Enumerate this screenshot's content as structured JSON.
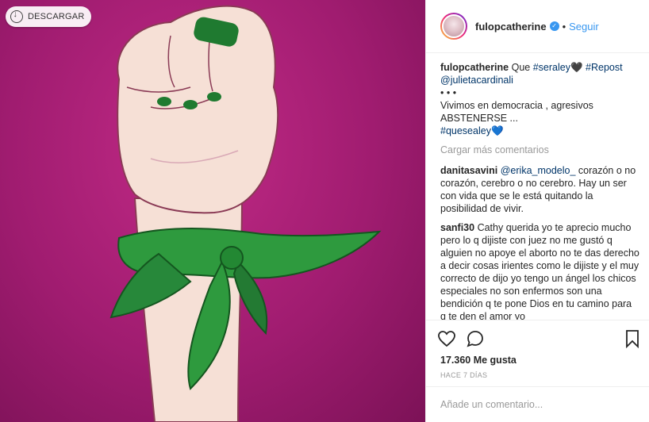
{
  "image": {
    "download_label": "DESCARGAR",
    "background_color": "#a01c70",
    "bandana_color": "#2e9a3e",
    "nail_color": "#1f7a30"
  },
  "header": {
    "username": "fulopcatherine",
    "separator": "•",
    "follow_label": "Seguir"
  },
  "caption": {
    "username": "fulopcatherine",
    "text_intro": "Que",
    "hashtag1": "#seraley",
    "emoji1": "🖤",
    "hashtag2": "#Repost",
    "mention": "@julietacardinali",
    "dots": "• • •",
    "line1": "Vivimos en democracia , agresivos",
    "line2": "ABSTENERSE ...",
    "hashtag3": "#quesealey",
    "emoji2": "💙"
  },
  "load_more": "Cargar más comentarios",
  "comments": [
    {
      "username": "danitasavini",
      "mention": "@erika_modelo_",
      "text": "corazón o no corazón, cerebro o no cerebro. Hay un ser con vida que se le está quitando la posibilidad de vivir."
    },
    {
      "username": "sanfi30",
      "text": "Cathy querida yo te aprecio mucho pero lo q dijiste con juez no me gustó q alguien no apoye el aborto no te das derecho a decir cosas irientes como le dijiste y el muy correcto de dijo yo tengo un ángel los chicos especiales no son enfermos son una bendición q te pone Dios en tu camino para q te den el amor yo"
    }
  ],
  "likes": "17.360 Me gusta",
  "time_ago": "HACE 7 DÍAS",
  "add_comment_placeholder": "Añade un comentario..."
}
